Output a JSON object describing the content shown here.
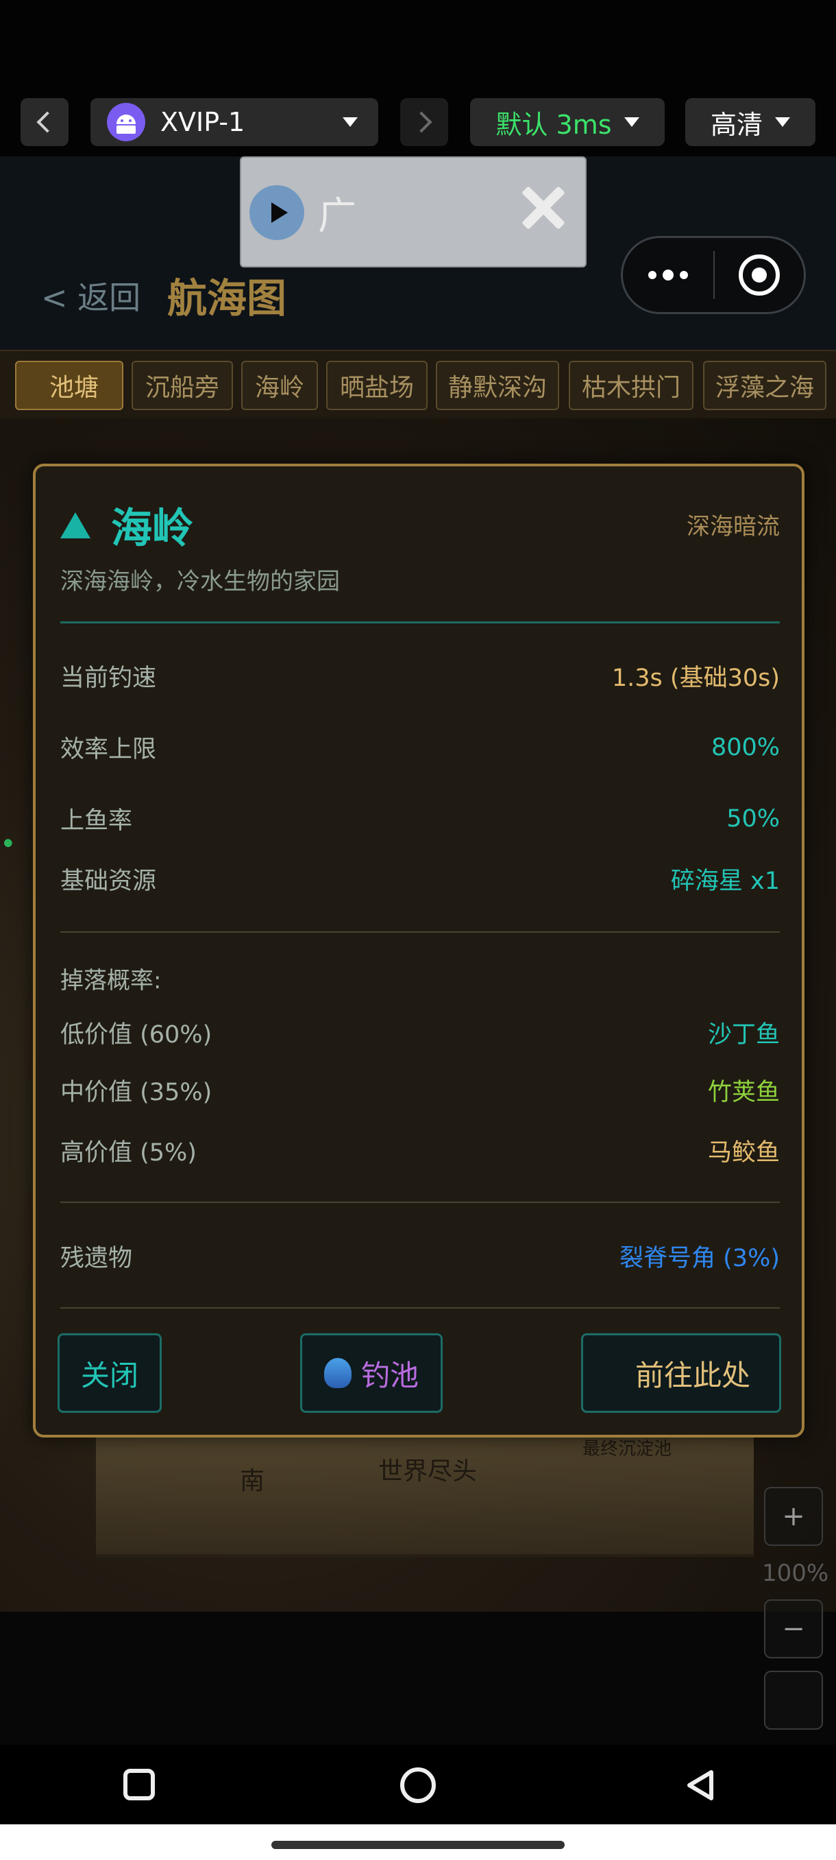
{
  "emulator": {
    "app_name": "XVIP-1",
    "speed": "默认 3ms",
    "quality": "高清"
  },
  "ad": {
    "text": "广"
  },
  "header": {
    "back": "< 返回",
    "title": "航海图",
    "pond_ghost": "池塘"
  },
  "tabs": [
    {
      "label": "池塘",
      "icon": "",
      "active": true
    },
    {
      "label": "沉船旁"
    },
    {
      "label": "海岭"
    },
    {
      "label": "晒盐场"
    },
    {
      "label": "静默深沟"
    },
    {
      "label": "枯木拱门"
    },
    {
      "label": "浮藻之海"
    }
  ],
  "map": {
    "labels": {
      "south": "南",
      "world_end": "世界尽头",
      "final_swamp": "最终沉淀池"
    },
    "zoom_in": "+",
    "zoom_level": "100%",
    "zoom_out": "−",
    "extra_icon": ""
  },
  "modal": {
    "name": "海岭",
    "zone": "深海暗流",
    "description": "深海海岭，冷水生物的家园",
    "stats": [
      {
        "key": "当前钓速",
        "value": "1.3s (基础30s)",
        "color": "#e4bb6e"
      },
      {
        "key": "效率上限",
        "value": "800%",
        "color": "#22c5b6"
      },
      {
        "key": "上鱼率",
        "value": "50%",
        "color": "#22c5b6"
      },
      {
        "key": "基础资源",
        "value": "碎海星 x1",
        "color": "#22c5b6"
      }
    ],
    "drop_title": "掉落概率:",
    "drops": [
      {
        "key": "低价值 (60%)",
        "value": "沙丁鱼",
        "color": "#22c5b6"
      },
      {
        "key": "中价值 (35%)",
        "value": "竹荚鱼",
        "color": "#8ed23c"
      },
      {
        "key": "高价值 (5%)",
        "value": "马鲛鱼",
        "color": "#e4bb6e"
      }
    ],
    "relic_key": "残遗物",
    "relic_value": "裂脊号角 (3%)",
    "buttons": {
      "close": "关闭",
      "pool": "钓池",
      "go": "前往此处",
      "go_icon": ""
    }
  }
}
